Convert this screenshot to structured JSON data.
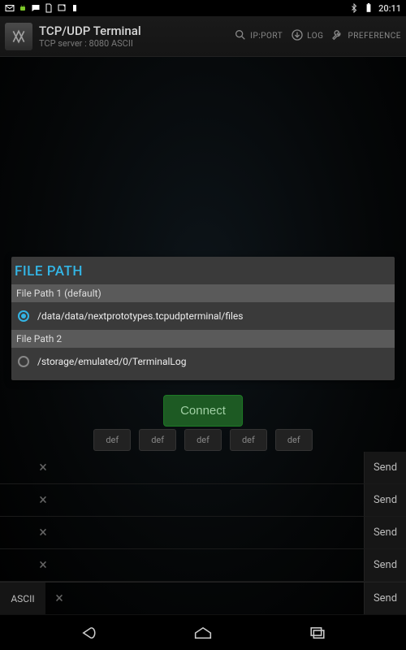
{
  "status": {
    "time": "20:11"
  },
  "header": {
    "title": "TCP/UDP Terminal",
    "subtitle": "TCP server : 8080  ASCII",
    "actions": {
      "ipport": "IP:PORT",
      "log": "LOG",
      "preference": "PREFERENCE"
    }
  },
  "panel": {
    "title": "FILE PATH",
    "section1_label": "File Path 1 (default)",
    "path1": "/data/data/nextprototypes.tcpudpterminal/files",
    "section2_label": "File Path 2",
    "path2": "/storage/emulated/0/TerminalLog"
  },
  "connect_label": "Connect",
  "def_labels": [
    "def",
    "def",
    "def",
    "def",
    "def"
  ],
  "send_label": "Send",
  "ascii_label": "ASCII"
}
